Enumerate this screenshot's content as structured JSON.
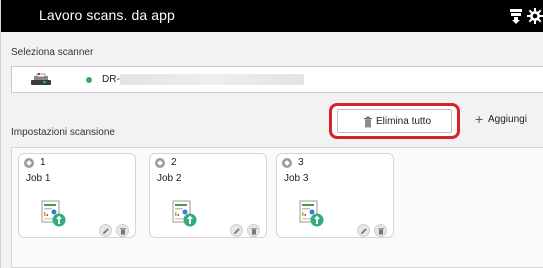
{
  "app": {
    "title": "Lavoro scans. da app"
  },
  "titlebar": {
    "scanner_icon": "scanner-settings-icon",
    "gear_icon": "gear-icon"
  },
  "scanner": {
    "section_label": "Seleziona scanner",
    "name": "DR-",
    "status_color": "#2db15f",
    "icon": "scanner-device-icon"
  },
  "scan_settings": {
    "section_label": "Impostazioni scansione",
    "delete_all_label": "Elimina tutto",
    "add_label": "Aggiungi",
    "highlight_color": "#d6232a"
  },
  "jobs": [
    {
      "number": "1",
      "name": "Job 1"
    },
    {
      "number": "2",
      "name": "Job 2"
    },
    {
      "number": "3",
      "name": "Job 3"
    }
  ]
}
